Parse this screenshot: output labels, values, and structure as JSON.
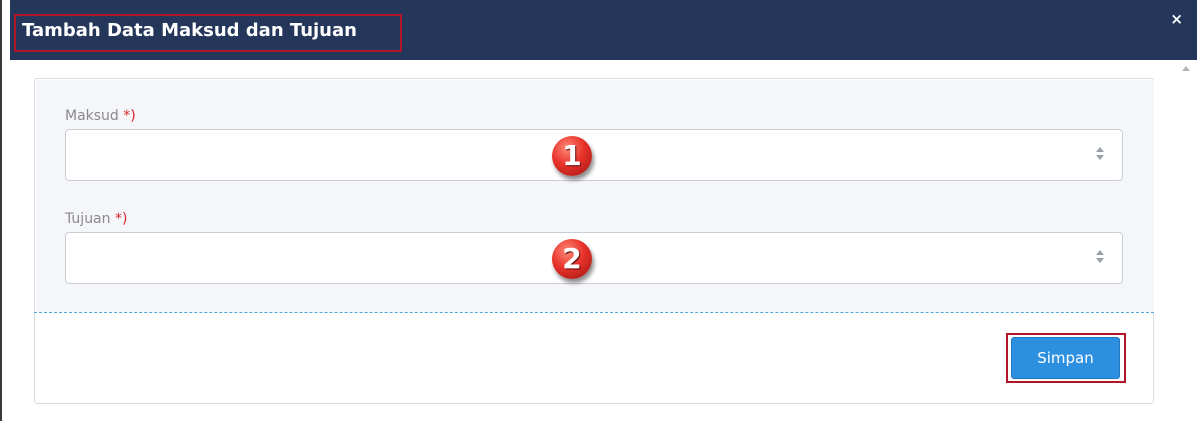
{
  "dialog": {
    "title": "Tambah Data Maksud dan Tujuan",
    "close_label": "×"
  },
  "form": {
    "fields": [
      {
        "label": "Maksud",
        "required_mark": "*)",
        "value": "",
        "marker": "1"
      },
      {
        "label": "Tujuan",
        "required_mark": "*)",
        "value": "",
        "marker": "2"
      }
    ],
    "submit_label": "Simpan"
  },
  "colors": {
    "header_bg": "#243659",
    "highlight_outline": "#b0152a",
    "primary_button": "#2c8fe0",
    "required": "#e0262c"
  }
}
